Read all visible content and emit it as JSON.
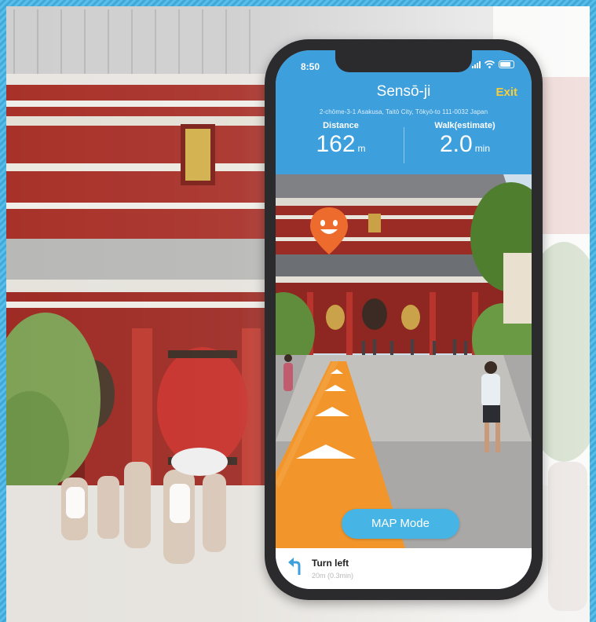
{
  "status_bar": {
    "time": "8:50"
  },
  "header": {
    "place_name": "Sensō-ji",
    "exit_label": "Exit",
    "address": "2-chōme-3-1 Asakusa, Taitō City, Tōkyō-to 111-0032 Japan"
  },
  "metrics": {
    "distance": {
      "label": "Distance",
      "value": "162",
      "unit": "m"
    },
    "walk": {
      "label": "Walk(estimate)",
      "value": "2.0",
      "unit": "min"
    }
  },
  "map_mode_button": {
    "label": "MAP Mode"
  },
  "navigation": {
    "instruction": "Turn left",
    "detail": "20m  (0.3min)"
  },
  "icons": {
    "destination_pin": "smiley-pin-icon",
    "turn": "turn-left-arrow-icon",
    "route_chevrons": "chevron-up-icon"
  },
  "colors": {
    "header_blue": "#3d9fdc",
    "exit_yellow": "#f7cd3a",
    "route_orange": "#f2962b",
    "pin_orange": "#ec6b2d",
    "map_button": "#46b4e4",
    "turn_icon": "#3d9fdc"
  }
}
